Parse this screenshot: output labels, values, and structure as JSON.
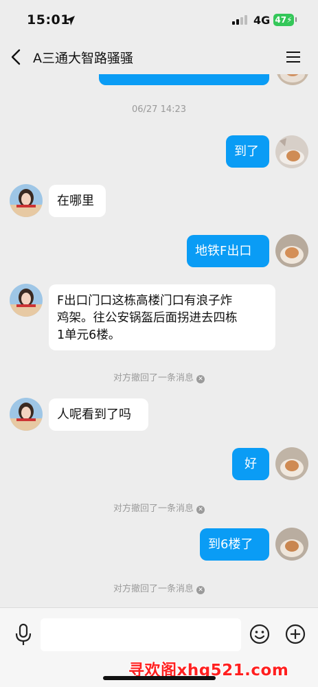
{
  "status": {
    "time": "15:01",
    "network": "4G",
    "battery": "47"
  },
  "nav": {
    "title": "A三通大智路骚骚"
  },
  "messages": {
    "timestamp": "06/27 14:23",
    "m1": "到了",
    "m2": "在哪里",
    "m3": "地铁F出口",
    "m4_line1": "F出口门口这栋高楼门口有浪子炸",
    "m4_line2": "鸡架。往公安锅盔后面拐进去四栋",
    "m4_line3": "1单元6楼。",
    "recall1": "对方撤回了一条消息",
    "m5": "人呢看到了吗",
    "m6": "好",
    "recall2": "对方撤回了一条消息",
    "m7": "到6楼了",
    "recall3": "对方撤回了一条消息"
  },
  "watermark": "寻欢阁xhg521.com",
  "colors": {
    "outgoing": "#0a9cf5",
    "incoming": "#ffffff",
    "background": "#ededed",
    "battery": "#34c759"
  }
}
